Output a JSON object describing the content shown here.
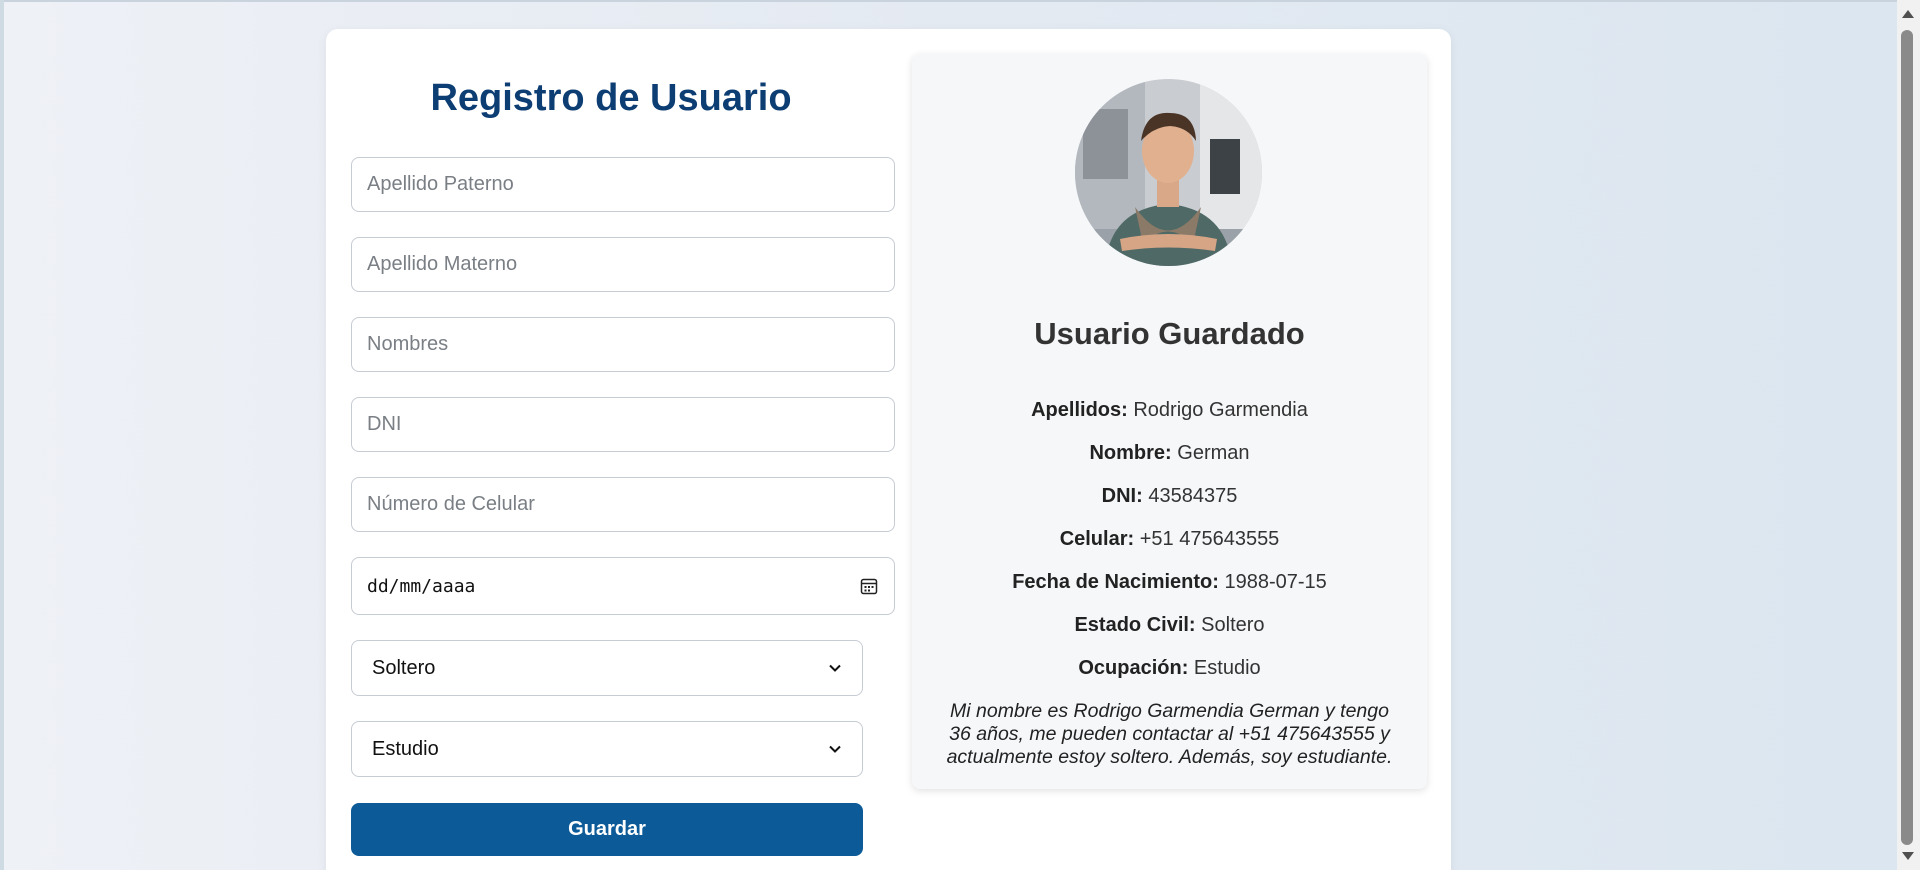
{
  "form": {
    "title": "Registro de Usuario",
    "fields": {
      "apellido_paterno_placeholder": "Apellido Paterno",
      "apellido_materno_placeholder": "Apellido Materno",
      "nombres_placeholder": "Nombres",
      "dni_placeholder": "DNI",
      "celular_placeholder": "Número de Celular",
      "fecha_placeholder": "dd/mm/aaaa"
    },
    "estado_civil_selected": "Soltero",
    "ocupacion_selected": "Estudio",
    "save_label": "Guardar"
  },
  "profile": {
    "title": "Usuario Guardado",
    "apellidos_label": "Apellidos:",
    "apellidos_value": "Rodrigo Garmendia",
    "nombre_label": "Nombre:",
    "nombre_value": "German",
    "dni_label": "DNI:",
    "dni_value": "43584375",
    "celular_label": "Celular:",
    "celular_value": "+51 475643555",
    "fecha_label": "Fecha de Nacimiento:",
    "fecha_value": "1988-07-15",
    "estado_label": "Estado Civil:",
    "estado_value": "Soltero",
    "ocupacion_label": "Ocupación:",
    "ocupacion_value": "Estudio",
    "bio": "Mi nombre es Rodrigo Garmendia German y tengo 36 años, me pueden contactar al +51 475643555 y actualmente estoy soltero. Además, soy estudiante."
  },
  "colors": {
    "title": "#0c3d73",
    "button": "#0c5a98"
  },
  "icons": {
    "date": "calendar-icon",
    "select": "chevron-down-icon"
  }
}
